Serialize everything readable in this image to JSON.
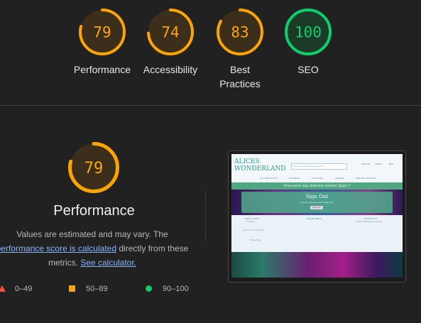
{
  "categories": [
    {
      "score": "79",
      "label": "Performance",
      "fraction": 0.79,
      "color": "#ffa400",
      "bg": "#3b2e1a"
    },
    {
      "score": "74",
      "label": "Accessibility",
      "fraction": 0.74,
      "color": "#ffa400",
      "bg": "#3b2e1a"
    },
    {
      "score": "83",
      "label": "Best Practices",
      "fraction": 0.83,
      "color": "#ffa400",
      "bg": "#3b2e1a"
    },
    {
      "score": "100",
      "label": "SEO",
      "fraction": 1.0,
      "color": "#0cce6b",
      "bg": "#1c3a28"
    }
  ],
  "performance": {
    "score": "79",
    "fraction": 0.79,
    "title": "Performance",
    "desc_prefix": "Values are estimated and may vary. The",
    "desc_link1": "performance score is calculated",
    "desc_middle": "directly from these metrics.",
    "desc_link2": "See calculator."
  },
  "legend": {
    "poor": "0–49",
    "average": "50–89",
    "good": "90–100"
  },
  "screenshot": {
    "logo_line1": "ALICES",
    "logo_line2": "WONDERLAND",
    "search_placeholder": "Search for something wonderful",
    "icons": [
      "SIGN UP",
      "LOGIN",
      "BAG"
    ],
    "nav": [
      "ALL PRODUCTS",
      "GOODIES",
      "CLOTHING",
      "JEWELS",
      "SPECIAL OFFERS"
    ],
    "banner": "Free next day delivery before 5pm! *",
    "card_title": "Sign Out",
    "card_sub": "Are you sure you want to sign out?",
    "card_btn": "Sign Out",
    "footer_col1": "USEFUL LINKS",
    "footer_col2": "SOCIAL MEDIA",
    "footer_col3": "CONTACT US",
    "footer_txt1": "Contact Us",
    "footer_txt2": "Sign up for our newsletter",
    "footer_txt3": "Privacy Policy",
    "footer_txt4": "alicewonderland@example.com"
  }
}
